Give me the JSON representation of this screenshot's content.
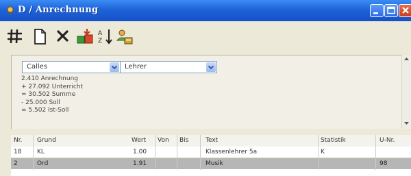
{
  "window": {
    "title": "D / Anrechnung",
    "title_icon": "pin-icon",
    "controls": [
      "minimize-icon",
      "maximize-icon",
      "close-icon"
    ]
  },
  "toolbar": {
    "buttons": [
      {
        "icon": "grid-icon"
      },
      {
        "icon": "new-document-icon"
      },
      {
        "icon": "delete-x-icon"
      },
      {
        "icon": "import-icon"
      },
      {
        "icon": "sort-icon"
      },
      {
        "icon": "people-icon"
      }
    ]
  },
  "filters": {
    "left_select": "Calles",
    "right_select": "Lehrer"
  },
  "calc": {
    "line1": "2.410 Anrechnung",
    "line2": "+ 27.092 Unterricht",
    "line3": "= 30.502 Summe",
    "line4": "- 25.000 Soll",
    "line5": "= 5.502 Ist-Soll"
  },
  "table": {
    "columns": [
      "Nr.",
      "Grund",
      "Wert",
      "Von",
      "Bis",
      "Text",
      "Statistik",
      "U-Nr."
    ],
    "rows": [
      {
        "nr": "18",
        "grund": "KL",
        "wert": "1.00",
        "von": "",
        "bis": "",
        "text": "Klassenlehrer 5a",
        "statistik": "K",
        "unr": ""
      },
      {
        "nr": "2",
        "grund": "Ord",
        "wert": "1.91",
        "von": "",
        "bis": "",
        "text": "Musik",
        "statistik": "",
        "unr": "98"
      }
    ]
  },
  "colors": {
    "titlebar": "#1f63d9",
    "selected_row": "#b6b6b6",
    "combo_border": "#7f9db9"
  }
}
